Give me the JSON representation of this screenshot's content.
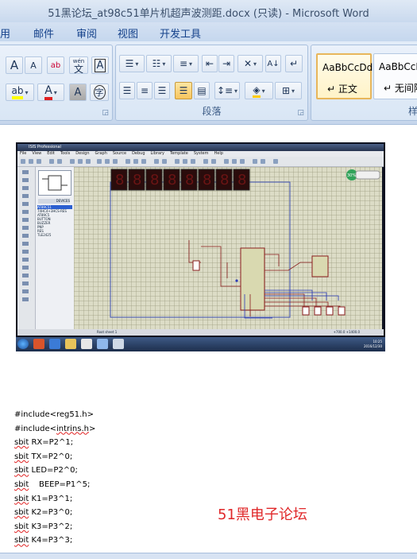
{
  "window": {
    "title": "51黑论坛_at98c51单片机超声波测距.docx (只读) - Microsoft Word"
  },
  "tabs": [
    {
      "label": "用"
    },
    {
      "label": "邮件"
    },
    {
      "label": "审阅"
    },
    {
      "label": "视图"
    },
    {
      "label": "开发工具"
    }
  ],
  "ribbon": {
    "font": {
      "grow": "A",
      "shrink": "A",
      "clear_format": "ab",
      "phonetic": "wén",
      "char_border": "A",
      "highlight": "ab",
      "font_color": "A",
      "char_shading": "A",
      "enclose": "字"
    },
    "paragraph": {
      "label": "段落",
      "shading_color": "#ffcc00"
    },
    "styles": {
      "items": [
        {
          "sample": "AaBbCcDd",
          "name": "正文"
        },
        {
          "sample": "AaBbCcD",
          "name": "无间隔"
        }
      ],
      "group_label_partial": "样"
    }
  },
  "screenshot": {
    "app_title": "ISIS Professional",
    "menu": [
      "File",
      "View",
      "Edit",
      "Tools",
      "Design",
      "Graph",
      "Source",
      "Debug",
      "Library",
      "Template",
      "System",
      "Help"
    ],
    "devices_label": "DEVICES",
    "devices": [
      "AT89C51",
      "74HC4+3HCS-RES",
      "AT89C5",
      "BUTTON",
      "BUZZER",
      "PNP",
      "RES",
      "TLE2425"
    ],
    "status_text": "Root sheet 1",
    "coords": "+700.0   +1400.0",
    "clock_time": "10:25",
    "clock_date": "2016/12/30",
    "badge": "30%"
  },
  "code_lines": [
    {
      "pre": "#include<reg51.h>",
      "wavy": "",
      "post": ""
    },
    {
      "pre": "#include<",
      "wavy": "intrins.h",
      "post": ">"
    },
    {
      "pre": "",
      "wavy": "sbit",
      "post": " RX=P2^1;"
    },
    {
      "pre": "",
      "wavy": "sbit",
      "post": " TX=P2^0;"
    },
    {
      "pre": "",
      "wavy": "sbit",
      "post": " LED=P2^0;"
    },
    {
      "pre": "",
      "wavy": "sbit",
      "post": "    BEEP=P1^5;"
    },
    {
      "pre": "",
      "wavy": "sbit",
      "post": " K1=P3^1;"
    },
    {
      "pre": "",
      "wavy": "sbit",
      "post": " K2=P3^0;"
    },
    {
      "pre": "",
      "wavy": "sbit",
      "post": " K3=P3^2;"
    },
    {
      "pre": "",
      "wavy": "sbit",
      "post": " K4=P3^3;"
    }
  ],
  "watermark": "51黑电子论坛"
}
